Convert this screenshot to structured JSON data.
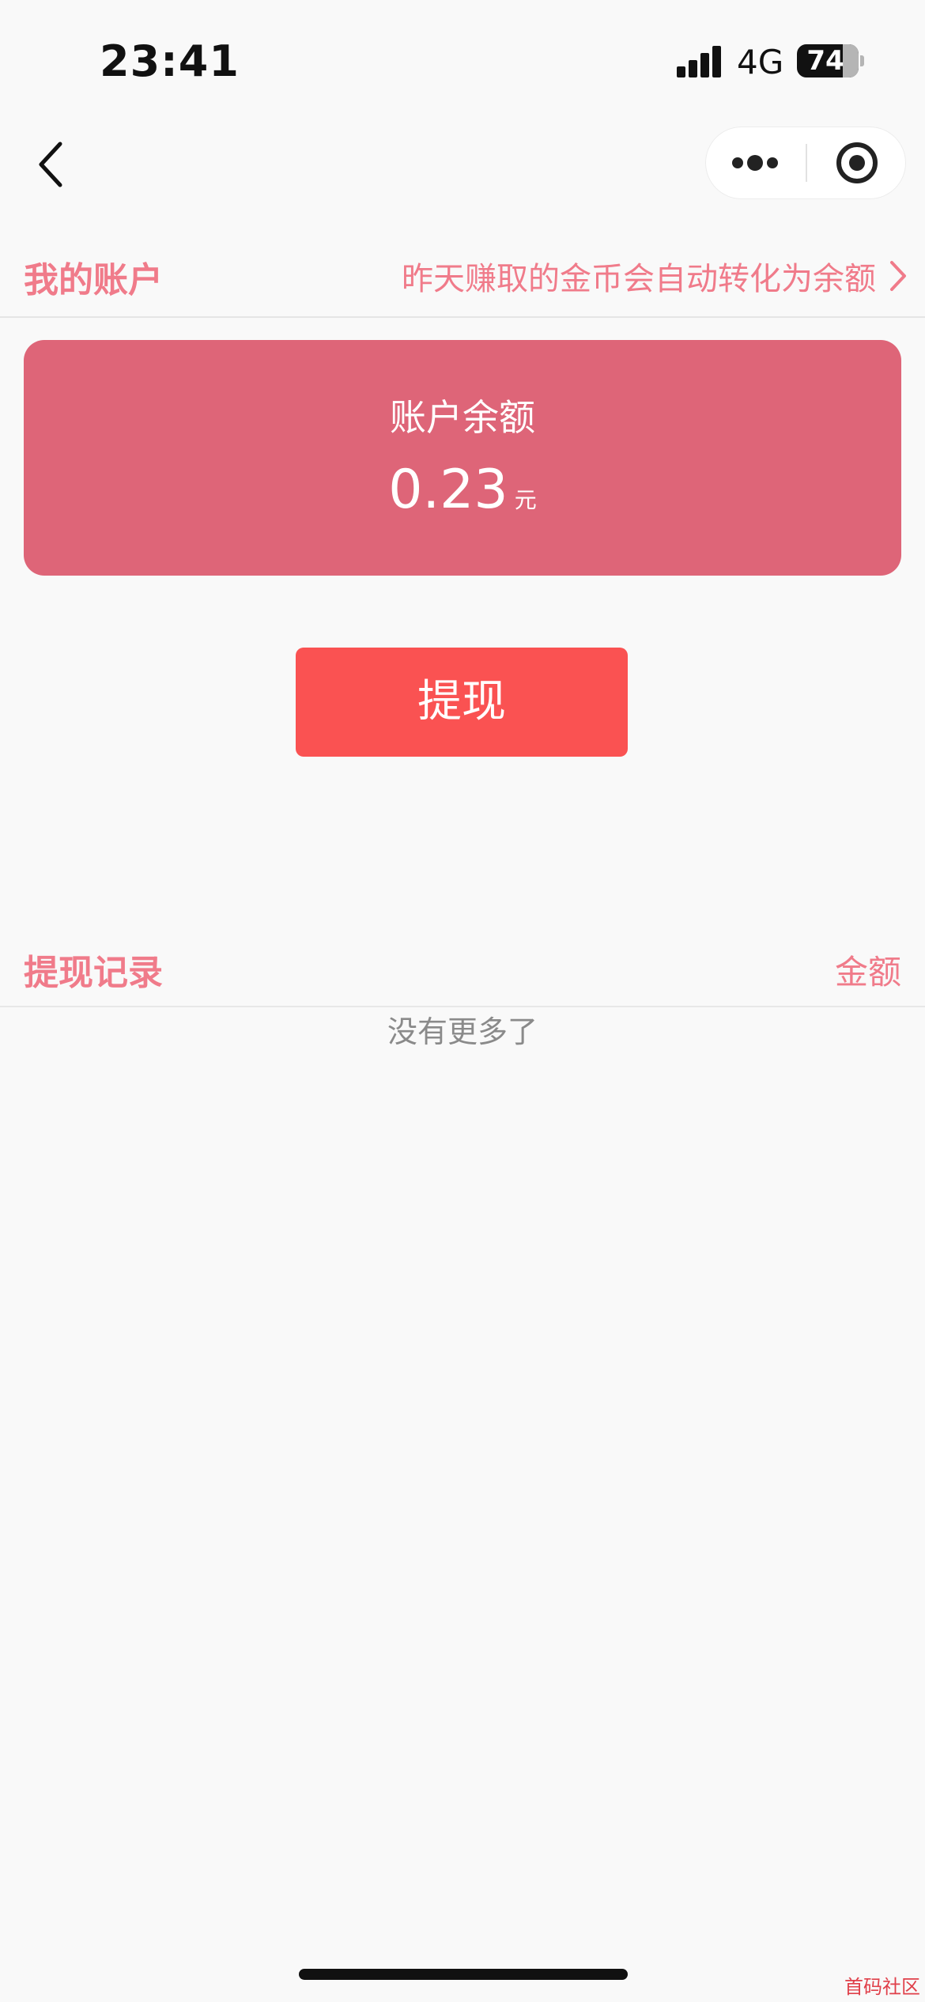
{
  "status_bar": {
    "time": "23:41",
    "network": "4G",
    "battery_level": "74"
  },
  "nav": {
    "back_icon": "chevron-left-icon",
    "menu_icon": "more-dots-icon",
    "close_icon": "target-circle-icon"
  },
  "account": {
    "title": "我的账户",
    "notice": "昨天赚取的金币会自动转化为余额",
    "notice_icon": "chevron-right-icon"
  },
  "balance": {
    "label": "账户余额",
    "amount": "0.23",
    "unit": "元"
  },
  "withdraw": {
    "button_label": "提现"
  },
  "records": {
    "title": "提现记录",
    "amount_column": "金额",
    "empty_text": "没有更多了"
  },
  "watermark": "首码社区",
  "colors": {
    "accent_text": "#f07b8a",
    "card_bg": "#de6578",
    "button_bg": "#fa5252"
  }
}
